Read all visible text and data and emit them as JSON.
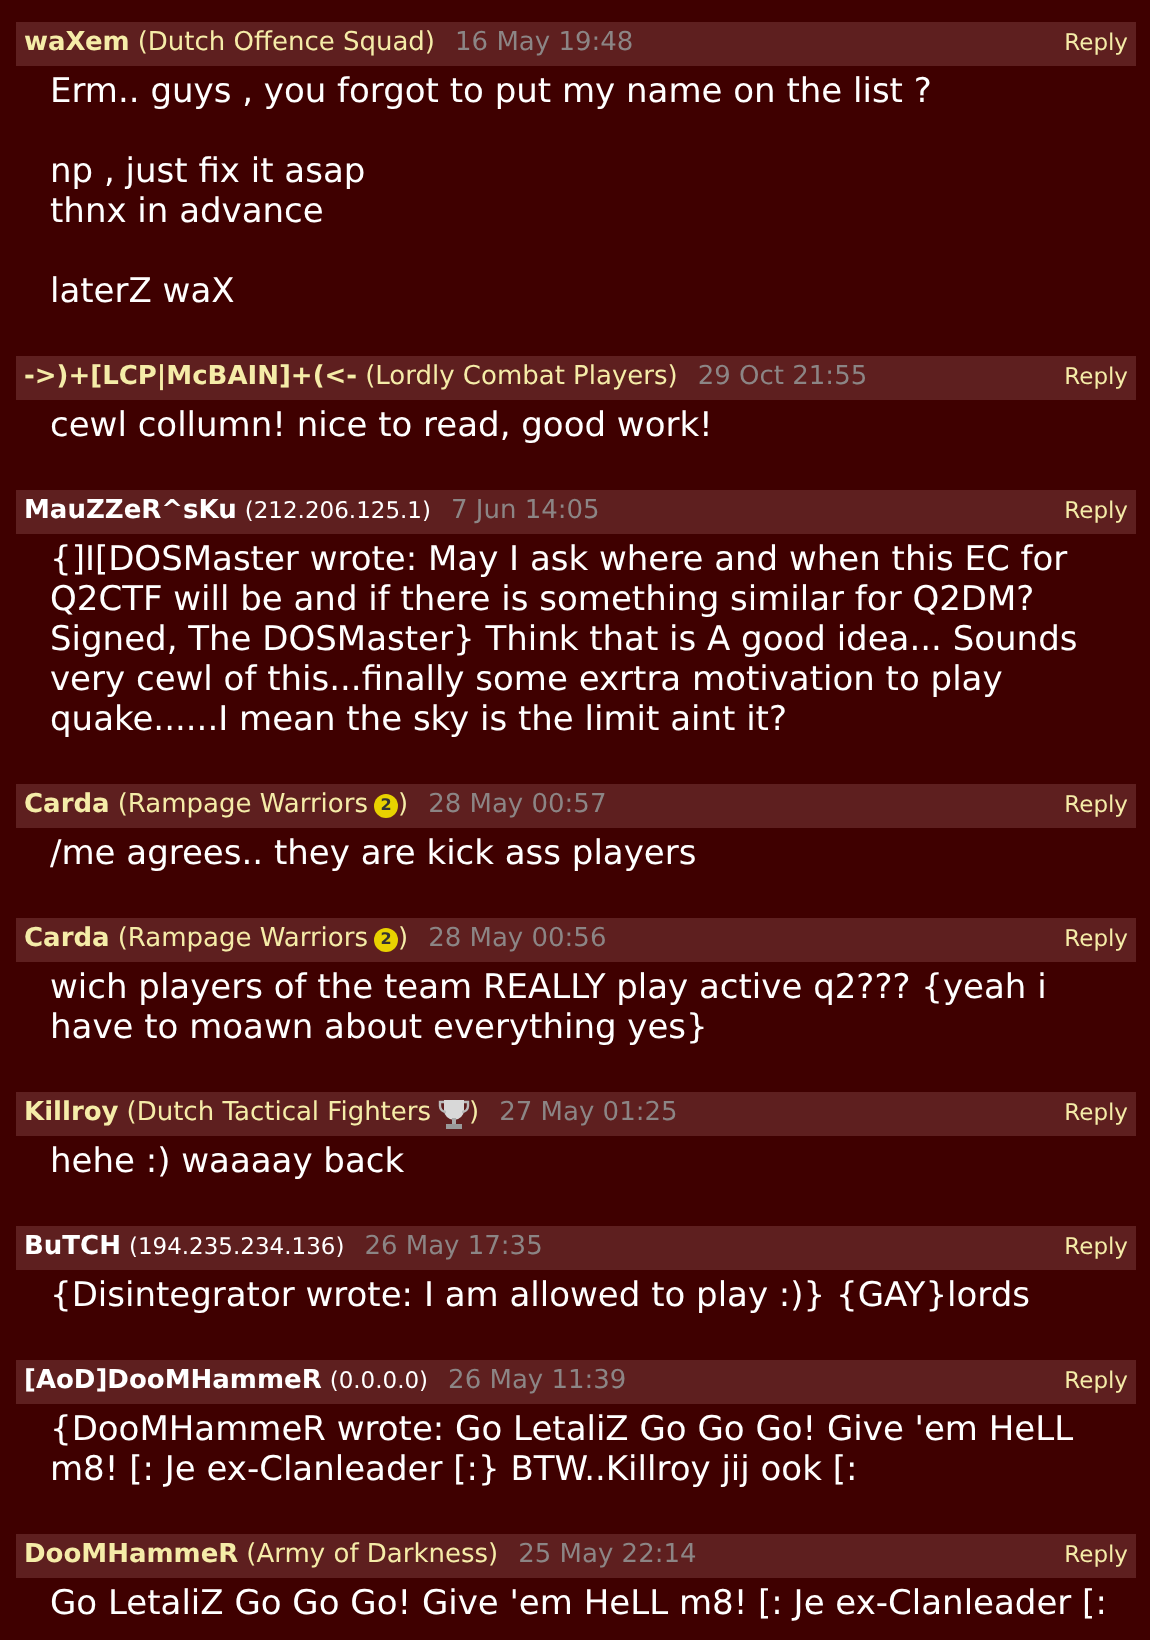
{
  "comments": [
    {
      "author": "waXem",
      "kind": "member",
      "affiliation": "(Dutch Offence Squad)",
      "date": "16 May 19:48",
      "reply": "Reply",
      "body": "Erm.. guys , you forgot to put my name on the list ?\n\nnp , just fix it asap\nthnx in advance\n\nlaterZ waX"
    },
    {
      "author": "->)+[LCP|McBAIN]+(<-",
      "kind": "member",
      "affiliation": "(Lordly Combat Players)",
      "date": "29 Oct 21:55",
      "reply": "Reply",
      "body": "cewl collumn! nice to read, good work!"
    },
    {
      "author": "MauZZeR^sKu",
      "kind": "guest",
      "affiliation": "(212.206.125.1)",
      "date": "7 Jun 14:05",
      "reply": "Reply",
      "body": "{]I[DOSMaster wrote: May I ask where and when this EC for Q2CTF will be and if there is something similar for Q2DM? Signed, The DOSMaster} Think that is A good idea... Sounds very cewl of this...finally some exrtra motivation to play quake......I mean the sky is the limit aint it?"
    },
    {
      "author": "Carda",
      "kind": "member",
      "affiliation": "(Rampage Warriors",
      "badge": {
        "kind": "medal",
        "label": "2"
      },
      "affiliation_end": ")",
      "date": "28 May 00:57",
      "reply": "Reply",
      "body": "/me agrees.. they are kick ass players"
    },
    {
      "author": "Carda",
      "kind": "member",
      "affiliation": "(Rampage Warriors",
      "badge": {
        "kind": "medal",
        "label": "2"
      },
      "affiliation_end": ")",
      "date": "28 May 00:56",
      "reply": "Reply",
      "body": "wich players of the team REALLY play active q2??? {yeah i have to moawn about everything yes}"
    },
    {
      "author": "Killroy",
      "kind": "member",
      "affiliation": "(Dutch Tactical Fighters",
      "badge": {
        "kind": "trophy"
      },
      "affiliation_end": ")",
      "date": "27 May 01:25",
      "reply": "Reply",
      "body": "hehe :) waaaay back"
    },
    {
      "author": "BuTCH",
      "kind": "guest",
      "affiliation": "(194.235.234.136)",
      "date": "26 May 17:35",
      "reply": "Reply",
      "body": "{Disintegrator wrote: I am allowed to play :)} {GAY}lords"
    },
    {
      "author": "[AoD]DooMHammeR",
      "kind": "guest",
      "affiliation": "(0.0.0.0)",
      "date": "26 May 11:39",
      "reply": "Reply",
      "body": "{DooMHammeR wrote: Go LetaliZ Go Go Go! Give 'em HeLL m8! [: Je ex-Clanleader [:} BTW..Killroy jij ook [:"
    },
    {
      "author": "DooMHammeR",
      "kind": "member",
      "affiliation": "(Army of Darkness)",
      "date": "25 May 22:14",
      "reply": "Reply",
      "body": "Go LetaliZ Go Go Go! Give 'em HeLL m8! [: Je ex-Clanleader [:"
    }
  ]
}
